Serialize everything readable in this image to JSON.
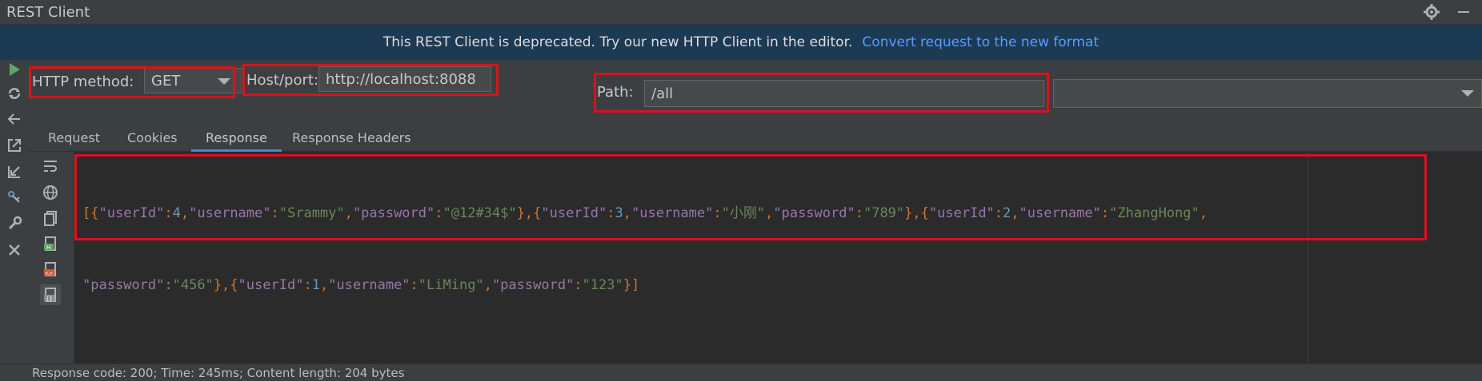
{
  "window": {
    "title": "REST Client"
  },
  "banner": {
    "message": "This REST Client is deprecated. Try our new HTTP Client in the editor.",
    "link": "Convert request to the new format"
  },
  "form": {
    "method_label": "HTTP method:",
    "method_value": "GET",
    "host_label": "Host/port:",
    "host_value": "http://localhost:8088",
    "path_label": "Path:",
    "path_value": "/all",
    "extra_value": ""
  },
  "tabs": [
    "Request",
    "Cookies",
    "Response",
    "Response Headers"
  ],
  "active_tab": "Response",
  "response": {
    "line1": [
      {
        "t": "p",
        "v": "["
      },
      {
        "t": "p",
        "v": "{"
      },
      {
        "t": "k",
        "v": "\"userId\""
      },
      {
        "t": "p",
        "v": ":"
      },
      {
        "t": "n",
        "v": "4"
      },
      {
        "t": "p",
        "v": ","
      },
      {
        "t": "k",
        "v": "\"username\""
      },
      {
        "t": "p",
        "v": ":"
      },
      {
        "t": "s",
        "v": "\"Srammy\""
      },
      {
        "t": "p",
        "v": ","
      },
      {
        "t": "k",
        "v": "\"password\""
      },
      {
        "t": "p",
        "v": ":"
      },
      {
        "t": "s",
        "v": "\"@12#34$\""
      },
      {
        "t": "p",
        "v": "}"
      },
      {
        "t": "p",
        "v": ","
      },
      {
        "t": "p",
        "v": "{"
      },
      {
        "t": "k",
        "v": "\"userId\""
      },
      {
        "t": "p",
        "v": ":"
      },
      {
        "t": "n",
        "v": "3"
      },
      {
        "t": "p",
        "v": ","
      },
      {
        "t": "k",
        "v": "\"username\""
      },
      {
        "t": "p",
        "v": ":"
      },
      {
        "t": "s",
        "v": "\"小刚\""
      },
      {
        "t": "p",
        "v": ","
      },
      {
        "t": "k",
        "v": "\"password\""
      },
      {
        "t": "p",
        "v": ":"
      },
      {
        "t": "s",
        "v": "\"789\""
      },
      {
        "t": "p",
        "v": "}"
      },
      {
        "t": "p",
        "v": ","
      },
      {
        "t": "p",
        "v": "{"
      },
      {
        "t": "k",
        "v": "\"userId\""
      },
      {
        "t": "p",
        "v": ":"
      },
      {
        "t": "n",
        "v": "2"
      },
      {
        "t": "p",
        "v": ","
      },
      {
        "t": "k",
        "v": "\"username\""
      },
      {
        "t": "p",
        "v": ":"
      },
      {
        "t": "s",
        "v": "\"ZhangHong\""
      },
      {
        "t": "p",
        "v": ","
      }
    ],
    "line2": [
      {
        "t": "k",
        "v": "\"password\""
      },
      {
        "t": "p",
        "v": ":"
      },
      {
        "t": "s",
        "v": "\"456\""
      },
      {
        "t": "p",
        "v": "}"
      },
      {
        "t": "p",
        "v": ","
      },
      {
        "t": "p",
        "v": "{"
      },
      {
        "t": "k",
        "v": "\"userId\""
      },
      {
        "t": "p",
        "v": ":"
      },
      {
        "t": "n",
        "v": "1"
      },
      {
        "t": "p",
        "v": ","
      },
      {
        "t": "k",
        "v": "\"username\""
      },
      {
        "t": "p",
        "v": ":"
      },
      {
        "t": "s",
        "v": "\"LiMing\""
      },
      {
        "t": "p",
        "v": ","
      },
      {
        "t": "k",
        "v": "\"password\""
      },
      {
        "t": "p",
        "v": ":"
      },
      {
        "t": "s",
        "v": "\"123\""
      },
      {
        "t": "p",
        "v": "}"
      },
      {
        "t": "p",
        "v": "]"
      }
    ]
  },
  "status": {
    "text": "Response code: 200; Time: 245ms; Content length: 204 bytes"
  },
  "colors": {
    "highlight_box": "#d4141e",
    "banner_bg": "#1d3a55",
    "link": "#589df6",
    "json_key": "#9876aa",
    "json_string": "#6a8759",
    "json_number": "#6897bb",
    "punctuation": "#cc7832",
    "tab_underline": "#4a88c7"
  }
}
